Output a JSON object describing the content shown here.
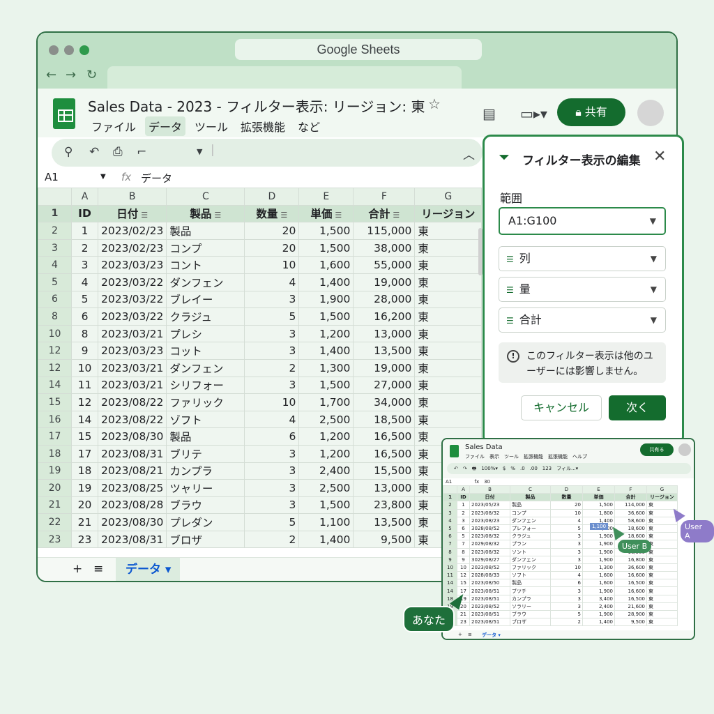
{
  "window": {
    "url_title": "Google Sheets"
  },
  "doc": {
    "title": "Sales Data - 2023 - フィルター表示: リージョン: 東",
    "menu": [
      "ファイル",
      "データ",
      "ツール",
      "拡張機能",
      "など"
    ],
    "active_menu_index": 1,
    "share_label": "共有"
  },
  "formula_bar": {
    "cell_ref": "A1",
    "fx": "fx",
    "value": "データ"
  },
  "grid": {
    "col_letters": [
      "A",
      "B",
      "C",
      "D",
      "E",
      "F",
      "G"
    ],
    "headers": [
      "ID",
      "日付",
      "製品",
      "数量",
      "単価",
      "合計",
      "リージョン"
    ],
    "rows": [
      {
        "rn": "2",
        "cells": [
          "1",
          "2023/02/23",
          "製品",
          "20",
          "1,500",
          "115,000",
          "東"
        ]
      },
      {
        "rn": "3",
        "cells": [
          "2",
          "2023/02/23",
          "コンプ",
          "20",
          "1,500",
          "38,000",
          "東"
        ]
      },
      {
        "rn": "4",
        "cells": [
          "3",
          "2023/03/23",
          "コント",
          "10",
          "1,600",
          "55,000",
          "東"
        ]
      },
      {
        "rn": "5",
        "cells": [
          "4",
          "2023/03/22",
          "ダンフェン",
          "4",
          "1,400",
          "19,000",
          "東"
        ]
      },
      {
        "rn": "6",
        "cells": [
          "5",
          "2023/03/22",
          "ブレイー",
          "3",
          "1,900",
          "28,000",
          "東"
        ]
      },
      {
        "rn": "8",
        "cells": [
          "6",
          "2023/03/22",
          "クラジュ",
          "5",
          "1,500",
          "16,200",
          "東"
        ]
      },
      {
        "rn": "10",
        "cells": [
          "8",
          "2023/03/21",
          "プレシ",
          "3",
          "1,200",
          "13,000",
          "東"
        ]
      },
      {
        "rn": "12",
        "cells": [
          "9",
          "2023/03/23",
          "コット",
          "3",
          "1,400",
          "13,500",
          "東"
        ]
      },
      {
        "rn": "12",
        "cells": [
          "10",
          "2023/03/21",
          "ダンフェン",
          "2",
          "1,300",
          "19,000",
          "東"
        ]
      },
      {
        "rn": "14",
        "cells": [
          "11",
          "2023/03/21",
          "シリフォー",
          "3",
          "1,500",
          "27,000",
          "東"
        ]
      },
      {
        "rn": "15",
        "cells": [
          "12",
          "2023/08/22",
          "ファリック",
          "10",
          "1,700",
          "34,000",
          "東"
        ]
      },
      {
        "rn": "16",
        "cells": [
          "14",
          "2023/08/22",
          "ゾフト",
          "4",
          "2,500",
          "18,500",
          "東"
        ]
      },
      {
        "rn": "17",
        "cells": [
          "15",
          "2023/08/30",
          "製品",
          "6",
          "1,200",
          "16,500",
          "東"
        ]
      },
      {
        "rn": "18",
        "cells": [
          "17",
          "2023/08/31",
          "ブリテ",
          "3",
          "1,200",
          "16,500",
          "東"
        ]
      },
      {
        "rn": "19",
        "cells": [
          "18",
          "2023/08/21",
          "カンプラ",
          "3",
          "2,400",
          "15,500",
          "東"
        ]
      },
      {
        "rn": "20",
        "cells": [
          "19",
          "2023/08/25",
          "ツャリー",
          "3",
          "2,500",
          "13,000",
          "東"
        ]
      },
      {
        "rn": "21",
        "cells": [
          "20",
          "2023/08/28",
          "ブラウ",
          "3",
          "1,500",
          "23,800",
          "東"
        ]
      },
      {
        "rn": "22",
        "cells": [
          "21",
          "2023/08/30",
          "プレダン",
          "5",
          "1,100",
          "13,500",
          "東"
        ]
      },
      {
        "rn": "23",
        "cells": [
          "23",
          "2023/08/31",
          "ブロザ",
          "2",
          "1,400",
          "9,500",
          "東"
        ]
      }
    ]
  },
  "sheet_tabs": {
    "plus": "+",
    "list": "≡",
    "active": "データ ▾"
  },
  "filter_panel": {
    "title": "フィルター表示の編集",
    "range_label": "範囲",
    "range_value": "A1:G100",
    "criteria": [
      "列",
      "量",
      "合計"
    ],
    "info": "このフィルター表示は他のユーザーには影響しません。",
    "cancel_label": "キャンセル",
    "next_label": "次く"
  },
  "mini": {
    "title": "Sales Data",
    "menu": "ファイル　表示　ツール　拡張機能　拡張機能　ヘルプ",
    "share": "共有る",
    "toolbar": "↶　↷　🖶　100%▾　$　%　.0　.00　123　フィル...▾",
    "cell_ref": "A1",
    "formula": "fx　30",
    "col_letters": [
      "A",
      "B",
      "C",
      "D",
      "E",
      "F",
      "G"
    ],
    "headers": [
      "ID",
      "日付",
      "製品",
      "数量",
      "単価",
      "合計",
      "リージョン"
    ],
    "rows": [
      {
        "rn": "2",
        "cells": [
          "1",
          "2023/05/23",
          "製品",
          "20",
          "1,500",
          "114,000",
          "東"
        ]
      },
      {
        "rn": "3",
        "cells": [
          "2",
          "2023/08/32",
          "コンプ",
          "10",
          "1,800",
          "36,600",
          "東"
        ]
      },
      {
        "rn": "4",
        "cells": [
          "3",
          "2023/08/23",
          "ダンフェン",
          "4",
          "1,400",
          "58,600",
          "東"
        ]
      },
      {
        "rn": "5",
        "cells": [
          "6",
          "3028/08/52",
          "プレフォー",
          "5",
          "1,900",
          "18,600",
          "東"
        ]
      },
      {
        "rn": "6",
        "cells": [
          "5",
          "2023/08/32",
          "クラジュ",
          "3",
          "1,900",
          "18,600",
          "東"
        ]
      },
      {
        "rn": "7",
        "cells": [
          "7",
          "2029/08/32",
          "プラン",
          "3",
          "1,900",
          "16,600",
          "東"
        ]
      },
      {
        "rn": "8",
        "cells": [
          "8",
          "2023/08/32",
          "ソント",
          "3",
          "1,900",
          "16,500",
          "東"
        ]
      },
      {
        "rn": "9",
        "cells": [
          "9",
          "3029/08/27",
          "ダンフェン",
          "3",
          "1,900",
          "16,800",
          "東"
        ]
      },
      {
        "rn": "10",
        "cells": [
          "10",
          "2023/08/52",
          "ファリック",
          "10",
          "1,300",
          "36,600",
          "東"
        ]
      },
      {
        "rn": "11",
        "cells": [
          "12",
          "2028/08/33",
          "ソフト",
          "4",
          "1,600",
          "16,600",
          "東"
        ]
      },
      {
        "rn": "14",
        "cells": [
          "15",
          "2023/08/50",
          "製品",
          "6",
          "1,600",
          "16,500",
          "東"
        ]
      },
      {
        "rn": "14",
        "cells": [
          "17",
          "2023/08/51",
          "ブツチ",
          "3",
          "1,900",
          "16,600",
          "東"
        ]
      },
      {
        "rn": "18",
        "cells": [
          "19",
          "2023/08/51",
          "カンプラ",
          "3",
          "3,400",
          "16,500",
          "東"
        ]
      },
      {
        "rn": "19",
        "cells": [
          "20",
          "2023/08/52",
          "ソラリー",
          "3",
          "2,400",
          "21,600",
          "東"
        ]
      },
      {
        "rn": "21",
        "cells": [
          "21",
          "2023/08/51",
          "ブラウ",
          "5",
          "1,900",
          "28,900",
          "東"
        ]
      },
      {
        "rn": "22",
        "cells": [
          "23",
          "2023/08/51",
          "ブロザ",
          "2",
          "1,400",
          "9,500",
          "東"
        ]
      }
    ],
    "tab": "データ ▾",
    "editing_chip": "1,100"
  },
  "collaborators": {
    "you": "あなた",
    "user_a": "User A",
    "user_b": "User B"
  },
  "colors": {
    "accent": "#146c2e",
    "header_bg": "#cfe4d2",
    "user_a": "#8e7bc9",
    "user_b": "#3f8f5a"
  }
}
